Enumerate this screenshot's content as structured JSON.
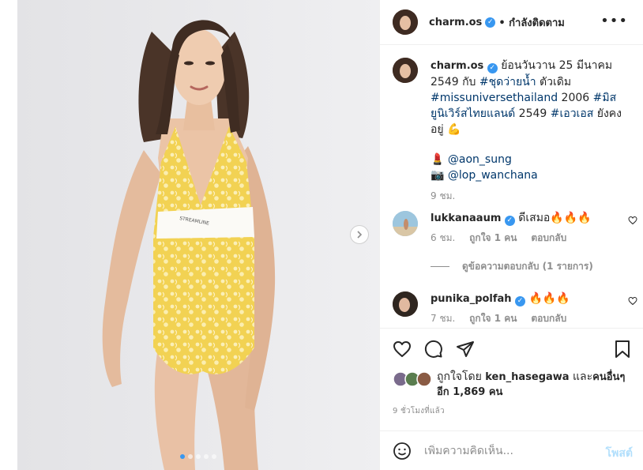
{
  "post": {
    "carousel": {
      "slide_count": 5,
      "active_slide": 1
    },
    "owner": {
      "handle": "charm.os",
      "verified": true,
      "follow_status": "• กำลังติดตาม"
    },
    "caption": {
      "handle": "charm.os",
      "text_1": "ย้อนวันวาน 25 มีนาคม 2549 กับ ",
      "tag_1": "#ชุดว่ายน้ำ",
      "text_2": " ตัวเดิม ",
      "tag_2": "#missuniversethailand",
      "text_3": " 2006 ",
      "tag_3": "#มิสยูนิเวิร์สไทยแลนด์",
      "text_4": " 2549 ",
      "tag_4": "#เอวเอส",
      "text_5": " ยังคงอยู่",
      "muscle_emoji": "💪",
      "credit_1_emoji": "💄",
      "credit_1": "@aon_sung",
      "credit_2_emoji": "📷",
      "credit_2": "@lop_wanchana",
      "time": "9 ชม."
    },
    "comments": [
      {
        "handle": "lukkanaaum",
        "verified": true,
        "text": "ดีเสมอ",
        "emoji": "🔥🔥🔥",
        "time": "6 ชม.",
        "likes": "ถูกใจ 1 คน",
        "reply": "ตอบกลับ"
      },
      {
        "handle": "punika_polfah",
        "verified": true,
        "text": "",
        "emoji": "🔥🔥🔥",
        "time": "7 ชม.",
        "likes": "ถูกใจ 1 คน",
        "reply": "ตอบกลับ"
      }
    ],
    "view_replies": "ดูข้อความตอบกลับ (1 รายการ)",
    "liked_by": {
      "prefix": "ถูกใจโดย ",
      "user": "ken_hasegawa",
      "middle": " และ",
      "others": "คนอื่นๆ อีก 1,869 คน"
    },
    "time_ago": "9 ชั่วโมงที่แล้ว",
    "add_comment": {
      "placeholder": "เพิ่มความคิดเห็น...",
      "post_label": "โพสต์"
    }
  },
  "colors": {
    "accent": "#3897f0",
    "link": "#00376b",
    "muted": "#8e8e8e",
    "post_disabled": "#b2dffc",
    "swimsuit": "#f4d95a"
  },
  "icons": [
    "chevron-right-icon",
    "verified-badge-icon",
    "more-icon",
    "heart-icon",
    "comment-icon",
    "share-icon",
    "bookmark-icon",
    "emoji-icon"
  ]
}
